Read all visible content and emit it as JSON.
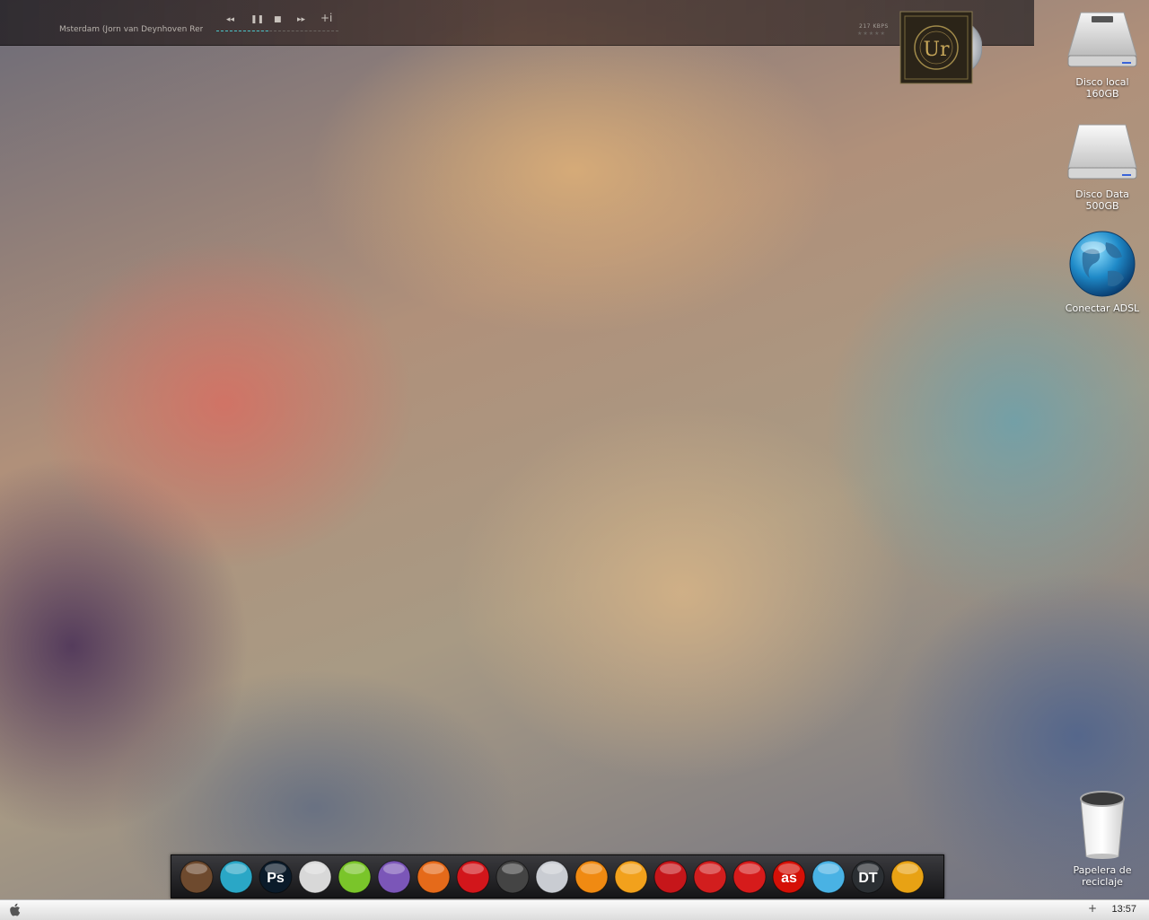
{
  "player": {
    "track_title": "Msterdam (Jorn van Deynhoven Remix",
    "controls": {
      "prev": "◂◂",
      "pause": "❚❚",
      "stop": "■",
      "next": "▸▸",
      "info": "+i"
    },
    "bitrate": "217 KBPS",
    "rating_stars": "★★★★★",
    "progress": 0.43,
    "album_art_icon": "album-cover-ur-icon"
  },
  "desktop_icons": [
    {
      "id": "disco-local",
      "line1": "Disco local",
      "line2": "160GB",
      "icon": "hard-drive-icon"
    },
    {
      "id": "disco-data",
      "line1": "Disco Data",
      "line2": "500GB",
      "icon": "hard-drive-icon"
    },
    {
      "id": "conectar-adsl",
      "line1": "Conectar ADSL",
      "line2": "",
      "icon": "globe-icon"
    },
    {
      "id": "papelera",
      "line1": "Papelera de",
      "line2": "reciclaje",
      "icon": "trash-bin-icon"
    }
  ],
  "dock": {
    "items": [
      {
        "name": "installer-icon",
        "color": "#6e4a2e"
      },
      {
        "name": "sync-icon",
        "color": "#2aa7c6"
      },
      {
        "name": "photoshop-icon",
        "color": "#0b1b2a",
        "text": "Ps"
      },
      {
        "name": "ghost-face-icon",
        "color": "#d8d8d8"
      },
      {
        "name": "green-pause-icon",
        "color": "#7ac52a"
      },
      {
        "name": "bird-messenger-icon",
        "color": "#7b56b8"
      },
      {
        "name": "firefox-icon",
        "color": "#e56a1a"
      },
      {
        "name": "opera-icon",
        "color": "#d2161b"
      },
      {
        "name": "music-disc-icon",
        "color": "#444444"
      },
      {
        "name": "cd-burner-icon",
        "color": "#c9ccd2"
      },
      {
        "name": "paw-player-icon",
        "color": "#f08a12"
      },
      {
        "name": "vlc-folder-icon",
        "color": "#f2a11c"
      },
      {
        "name": "red-record-icon",
        "color": "#c6161a"
      },
      {
        "name": "crossed-wheel-icon",
        "color": "#d21e1e"
      },
      {
        "name": "red-disc-icon",
        "color": "#d61b1b"
      },
      {
        "name": "lastfm-icon",
        "color": "#d51007",
        "text": "as"
      },
      {
        "name": "twitter-bird-icon",
        "color": "#49b2e4"
      },
      {
        "name": "dt-icon",
        "color": "#2b2f33",
        "text": "DT"
      },
      {
        "name": "star-smiley-icon",
        "color": "#e8a214"
      }
    ]
  },
  "taskbar": {
    "start_icon": "apple-logo-icon",
    "tray_plus": "+",
    "clock": "13:57"
  }
}
